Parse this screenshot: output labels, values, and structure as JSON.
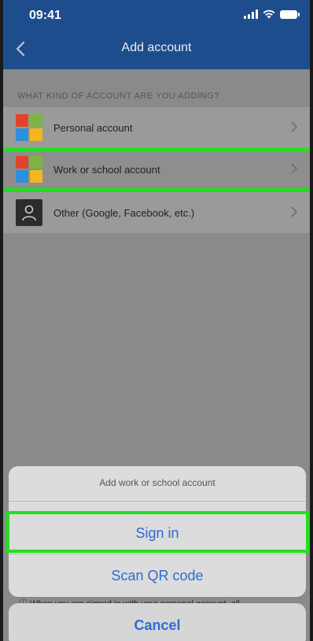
{
  "status_bar": {
    "time": "09:41"
  },
  "nav": {
    "title": "Add account",
    "back_icon": "chevron-left-icon"
  },
  "section": {
    "header": "WHAT KIND OF ACCOUNT ARE YOU ADDING?"
  },
  "accounts": [
    {
      "label": "Personal account",
      "icon": "microsoft-logo-icon"
    },
    {
      "label": "Work or school account",
      "icon": "microsoft-logo-icon"
    },
    {
      "label": "Other (Google, Facebook, etc.)",
      "icon": "person-icon"
    }
  ],
  "action_sheet": {
    "title": "Add work or school account",
    "sign_in": "Sign in",
    "scan_qr": "Scan QR code",
    "cancel": "Cancel"
  },
  "background_text": "ⓘ  When you are signed in with your personal account, all",
  "colors": {
    "header_bg": "#1d4d8c",
    "accent": "#2f6bd2",
    "highlight": "#22e01f",
    "ms_red": "#e0452b",
    "ms_green": "#7db544",
    "ms_blue": "#2f8fdd",
    "ms_yellow": "#f3b61d"
  }
}
